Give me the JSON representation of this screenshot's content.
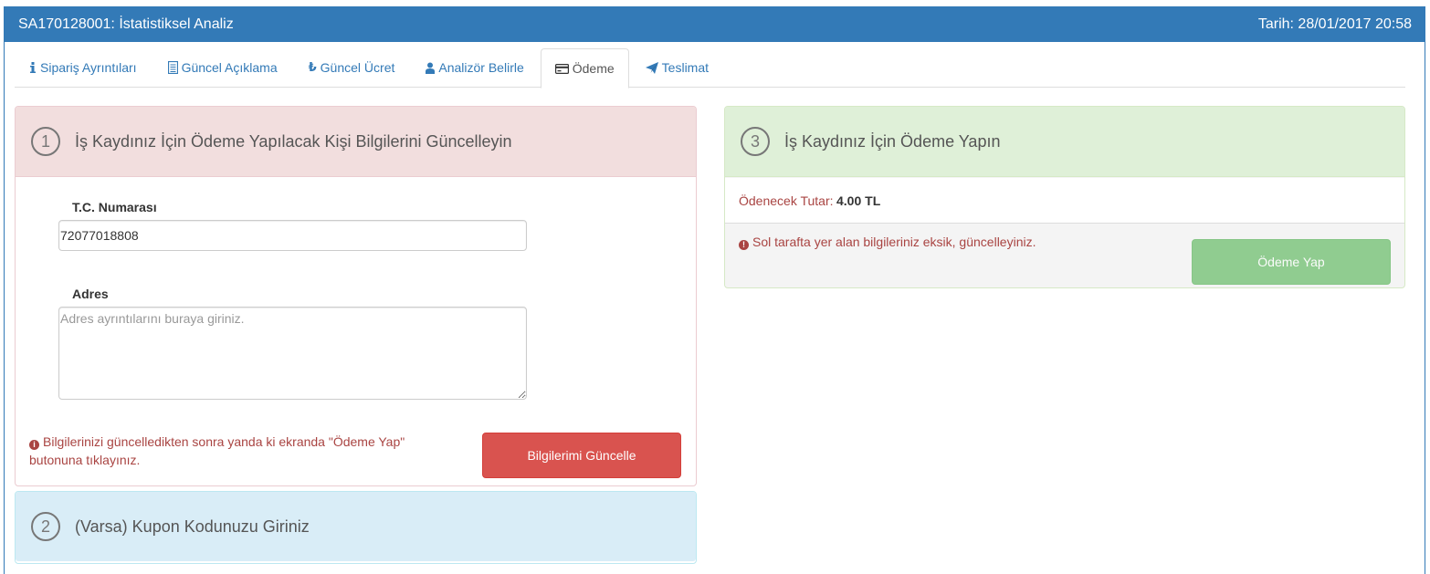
{
  "header": {
    "title": "SA170128001: İstatistiksel Analiz",
    "date": "Tarih: 28/01/2017 20:58"
  },
  "tabs": [
    {
      "label": "Sipariş Ayrıntıları",
      "icon": "info-icon",
      "active": false
    },
    {
      "label": "Güncel Açıklama",
      "icon": "document-icon",
      "active": false
    },
    {
      "label": "Güncel Ücret",
      "icon": "lira-icon",
      "active": false
    },
    {
      "label": "Analizör Belirle",
      "icon": "user-icon",
      "active": false
    },
    {
      "label": "Ödeme",
      "icon": "credit-card-icon",
      "active": true
    },
    {
      "label": "Teslimat",
      "icon": "send-icon",
      "active": false
    }
  ],
  "step1": {
    "number": "1",
    "title": "İş Kaydınız İçin Ödeme Yapılacak Kişi Bilgilerini Güncelleyin",
    "tc_label": "T.C. Numarası",
    "tc_value": "72077018808",
    "address_label": "Adres",
    "address_placeholder": "Adres ayrıntılarını buraya giriniz.",
    "note_line1": "Bilgilerinizi güncelledikten sonra yanda ki ekranda \"Ödeme Yap\"",
    "note_line2": "butonuna tıklayınız.",
    "button": "Bilgilerimi Güncelle"
  },
  "step2": {
    "number": "2",
    "title": "(Varsa) Kupon Kodunuzu Giriniz"
  },
  "step3": {
    "number": "3",
    "title": "İş Kaydınız İçin Ödeme Yapın",
    "amount_label": "Ödenecek Tutar:",
    "amount_value": "4.00 TL",
    "warning": "Sol tarafta yer alan bilgileriniz eksik, güncelleyiniz.",
    "button": "Ödeme Yap"
  },
  "colors": {
    "primary": "#337ab7",
    "danger": "#d9534f",
    "success": "#5cb85c",
    "danger_text": "#a94442"
  }
}
